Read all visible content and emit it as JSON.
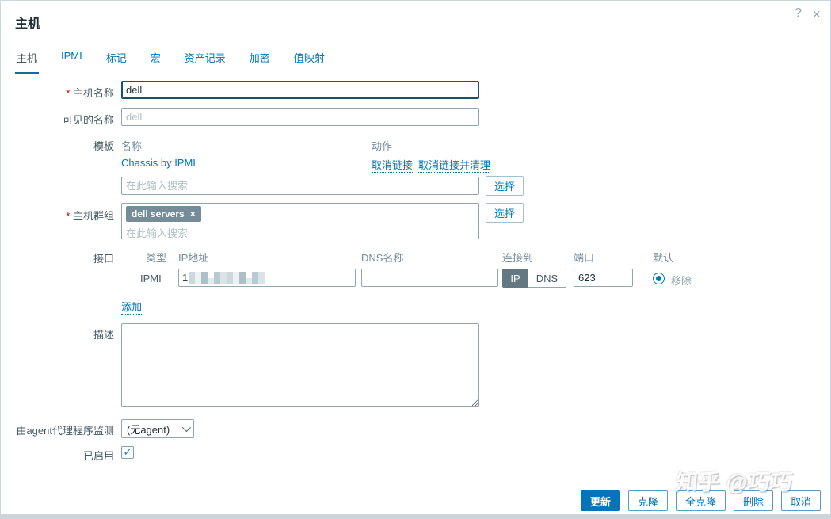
{
  "dialog": {
    "title": "主机"
  },
  "icons": {
    "help": "?",
    "close": "×",
    "check": "✓",
    "chip_remove": "×"
  },
  "tabs": [
    {
      "label": "主机",
      "active": true
    },
    {
      "label": "IPMI",
      "active": false
    },
    {
      "label": "标记",
      "active": false
    },
    {
      "label": "宏",
      "active": false
    },
    {
      "label": "资产记录",
      "active": false
    },
    {
      "label": "加密",
      "active": false
    },
    {
      "label": "值映射",
      "active": false
    }
  ],
  "form": {
    "host_name": {
      "label": "主机名称",
      "required": true,
      "value": "dell"
    },
    "visible_name": {
      "label": "可见的名称",
      "placeholder": "dell"
    },
    "templates": {
      "label": "模板",
      "col_name": "名称",
      "col_action": "动作",
      "linked": [
        {
          "name": "Chassis by IPMI",
          "unlink": "取消链接",
          "unlink_clear": "取消链接并清理"
        }
      ],
      "search_placeholder": "在此输入搜索",
      "select_button": "选择"
    },
    "host_groups": {
      "label": "主机群组",
      "required": true,
      "chips": [
        {
          "label": "dell servers"
        }
      ],
      "search_placeholder": "在此输入搜索",
      "select_button": "选择"
    },
    "interfaces": {
      "label": "接口",
      "columns": {
        "type": "类型",
        "ip": "IP地址",
        "dns": "DNS名称",
        "connect_to": "连接到",
        "port": "端口",
        "default": "默认"
      },
      "rows": [
        {
          "type": "IPMI",
          "ip_prefix": "1",
          "ip_redacted": true,
          "dns_value": "",
          "connect_options": [
            "IP",
            "DNS"
          ],
          "connect_selected": "IP",
          "port": "623",
          "default_selected": true,
          "remove_label": "移除"
        }
      ],
      "add_label": "添加"
    },
    "description": {
      "label": "描述",
      "value": ""
    },
    "proxy": {
      "label": "由agent代理程序监测",
      "value": "(无agent)"
    },
    "enabled": {
      "label": "已启用",
      "checked": true
    }
  },
  "footer": {
    "buttons": [
      {
        "label": "更新",
        "primary": true
      },
      {
        "label": "克隆",
        "primary": false
      },
      {
        "label": "全克隆",
        "primary": false
      },
      {
        "label": "删除",
        "primary": false
      },
      {
        "label": "取消",
        "primary": false
      }
    ]
  },
  "watermark": "知乎 @巧巧",
  "colors": {
    "accent": "#0275b8",
    "chip_bg": "#768d99",
    "toggle_active_bg": "#647882",
    "required_red": "#d40000"
  }
}
